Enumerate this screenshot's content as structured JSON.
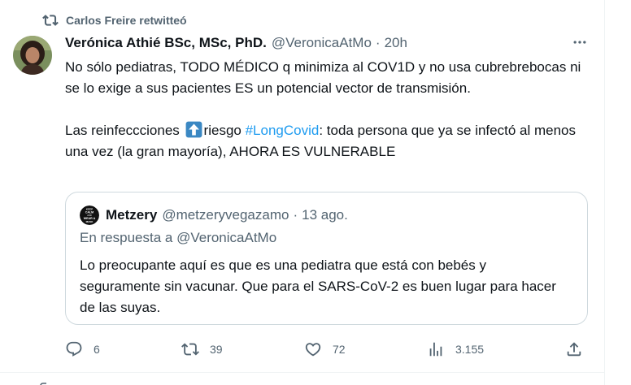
{
  "social_context": {
    "label": "Carlos Freire retwitteó"
  },
  "tweet": {
    "display_name": "Verónica Athié BSc, MSc, PhD.",
    "handle": "@VeronicaAtMo",
    "separator": "·",
    "time": "20h",
    "paragraph1": "No sólo pediatras, TODO MÉDICO q minimiza al COV1D y no usa cubrebrebocas ni se lo exige a sus pacientes ES un potencial vector de transmisión.",
    "paragraph2_part1": "Las reinfeccciones",
    "paragraph2_part2": "riesgo",
    "hashtag": "#LongCovid",
    "paragraph2_part3": ": toda persona que ya se infectó al menos una vez (la gran mayoría), AHORA ES VULNERABLE"
  },
  "quote": {
    "display_name": "Metzery",
    "handle": "@metzeryvegazamo",
    "separator": "·",
    "time": "13 ago.",
    "reply_context": "En respuesta a @VeronicaAtMo",
    "text": "Lo preocupante aquí es que es una pediatra que está con bebés y seguramente sin vacunar. Que para el SARS-CoV-2 es buen lugar para hacer de las suyas.",
    "avatar_text": {
      "line1": "KEEP",
      "line2": "CALM",
      "line3": "AND",
      "line4": "WEAR A",
      "line5": "MASK"
    }
  },
  "actions": {
    "reply_count": "6",
    "retweet_count": "39",
    "like_count": "72",
    "view_count": "3.155"
  },
  "icons": {
    "retweet": "retweet-icon",
    "more": "more-dots-icon",
    "up_arrow_emoji": "up-arrow-emoji",
    "reply": "reply-icon",
    "like": "heart-icon",
    "views": "views-icon",
    "share": "share-icon"
  },
  "colors": {
    "accent": "#1d9bf0",
    "secondary_text": "#536471",
    "primary_text": "#0f1419",
    "border": "#cfd9de",
    "emoji_blue": "#3b88c3"
  }
}
